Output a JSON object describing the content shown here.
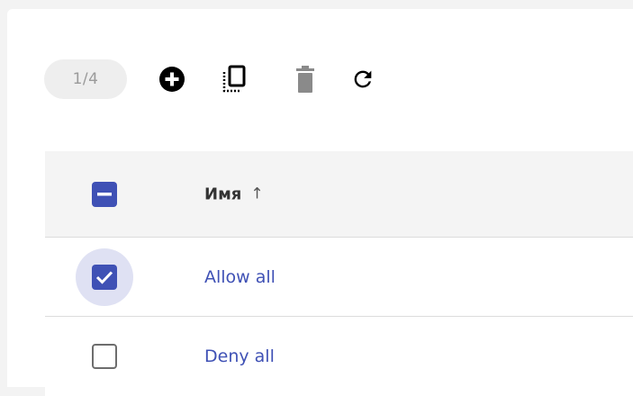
{
  "toolbar": {
    "page_counter": "1/4",
    "icons": [
      "add-circle-icon",
      "clone-icon",
      "delete-icon",
      "refresh-icon"
    ],
    "colors": {
      "icon_active": "#000000",
      "icon_disabled": "#8a8a8a"
    }
  },
  "table": {
    "header": {
      "select_all_state": "indeterminate",
      "name_label": "Имя",
      "sort_indicator": "↑"
    },
    "rows": [
      {
        "name": "Allow all",
        "checked": true
      },
      {
        "name": "Deny all",
        "checked": false
      }
    ]
  },
  "colors": {
    "accent": "#3f51b5",
    "header_bg": "#f4f4f4",
    "focus_ring": "#dfe1f3"
  }
}
